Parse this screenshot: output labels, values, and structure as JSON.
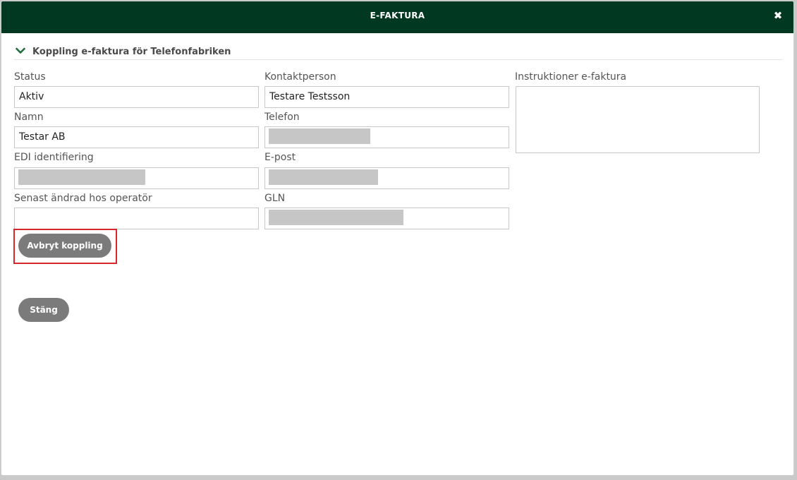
{
  "dialog": {
    "title": "E-FAKTURA",
    "close_icon": "close-icon"
  },
  "section": {
    "title": "Koppling e-faktura för Telefonfabriken",
    "icon": "chevron-down-icon"
  },
  "fields": {
    "status": {
      "label": "Status",
      "value": "Aktiv"
    },
    "namn": {
      "label": "Namn",
      "value": "Testar AB"
    },
    "edi": {
      "label": "EDI identifiering",
      "value": ""
    },
    "senast": {
      "label": "Senast ändrad hos operatör",
      "value": ""
    },
    "kontakt": {
      "label": "Kontaktperson",
      "value": "Testare Testsson"
    },
    "telefon": {
      "label": "Telefon",
      "value": ""
    },
    "epost": {
      "label": "E-post",
      "value": ""
    },
    "gln": {
      "label": "GLN",
      "value": ""
    },
    "instruktioner": {
      "label": "Instruktioner e-faktura",
      "value": ""
    }
  },
  "buttons": {
    "cancel_link": "Avbryt koppling",
    "close": "Stäng"
  },
  "colors": {
    "header_bg": "#013822",
    "chevron": "#1e6b3c",
    "button_bg": "#7b7b7b",
    "highlight": "#d8262c"
  }
}
